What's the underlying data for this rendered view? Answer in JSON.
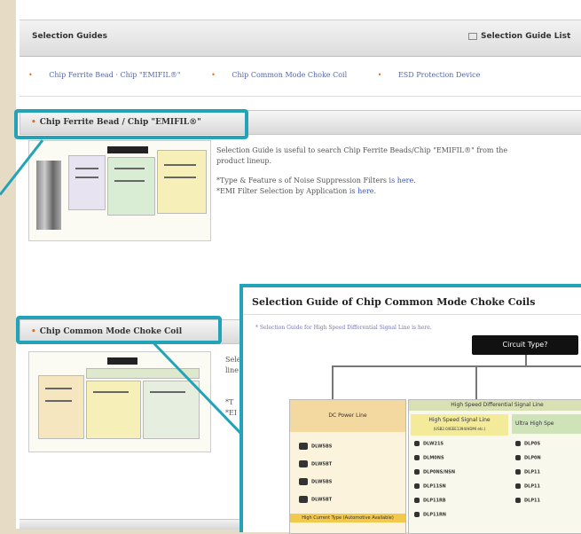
{
  "header": {
    "title": "Selection Guides",
    "list_label": "Selection Guide List"
  },
  "links": [
    {
      "label": "Chip Ferrite Bead · Chip \"EMIFIL®\""
    },
    {
      "label": "Chip Common Mode Choke Coil"
    },
    {
      "label": "ESD Protection Device"
    }
  ],
  "sections": {
    "ferrite": {
      "title": "Chip Ferrite Bead / Chip \"EMIFIL®\"",
      "desc": "Selection Guide is useful to search Chip Ferrite Beads/Chip \"EMIFIL®\" from the",
      "desc2": "product lineup.",
      "link1_prefix": "*Type & Feature s of Noise Suppression Filters",
      "link1": "is here.",
      "link2_prefix": "*EMI Filter Selection by Application",
      "link2": "is here."
    },
    "choke": {
      "title": "Chip Common Mode Choke Coil",
      "frag1": "Sele",
      "frag2": "line",
      "frag3": "*T",
      "frag4": "*EI"
    }
  },
  "popup": {
    "title": "Selection Guide of Chip Common Mode Choke Coils",
    "subtitle": "* Selection Guide for High Speed Differential Signal Line is here.",
    "circuit": "Circuit Type?",
    "dc_head": "DC Power Line",
    "hs_head": "High Speed Differential Signal Line",
    "hs_sub1": "High Speed Signal Line",
    "hs_sub1_note": "(USB2.0/IEEE1394/HDMI etc.)",
    "hs_sub2": "Ultra High Spe",
    "dc_rows": [
      "DLW5BS",
      "DLW5BT",
      "DLW5BS",
      "DLW5BT"
    ],
    "hs_rows": [
      "DLW21S",
      "DLM0NS",
      "DLP0NS/NSN",
      "DLP11SN",
      "DLP11RB",
      "DLP11RN"
    ],
    "uhs_rows": [
      "DLP0S",
      "DLP0N",
      "DLP11",
      "DLP11",
      "DLP11"
    ],
    "banner": "High Current Type (Automotive Available)"
  },
  "colors": {
    "highlight": "#22a3b8",
    "link": "#3355cc",
    "bullet": "#e07020"
  }
}
